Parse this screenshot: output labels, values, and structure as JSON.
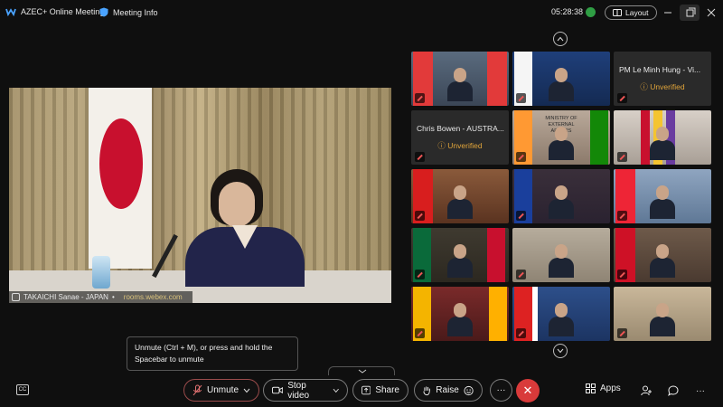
{
  "titlebar": {
    "app_title": "AZEC+ Online Meeting",
    "meeting_info": "Meeting Info",
    "time": "05:28:38",
    "layout_label": "Layout"
  },
  "main_video": {
    "participant_name": "TAKAICHI Sanae - JAPAN",
    "watermark": "rooms.webex.com"
  },
  "grid": {
    "tiles": [
      {
        "type": "video"
      },
      {
        "type": "video"
      },
      {
        "type": "text",
        "name": "PM Le Minh Hung - Vi...",
        "status": "Unverified"
      },
      {
        "type": "text",
        "name": "Chris Bowen - AUSTRA...",
        "status": "Unverified"
      },
      {
        "type": "video",
        "caption": "MINISTRY OF EXTERNAL AFFAIRS"
      },
      {
        "type": "video"
      },
      {
        "type": "video"
      },
      {
        "type": "video"
      },
      {
        "type": "video"
      },
      {
        "type": "video"
      },
      {
        "type": "video"
      },
      {
        "type": "video"
      },
      {
        "type": "video"
      },
      {
        "type": "video"
      },
      {
        "type": "video"
      }
    ]
  },
  "tooltip": {
    "text_line1": "Unmute (Ctrl + M), or press and hold the",
    "text_line2": "Spacebar to unmute"
  },
  "controls": {
    "unmute": "Unmute",
    "stop_video": "Stop video",
    "share": "Share",
    "raise": "Raise",
    "more": "···",
    "apps": "Apps"
  },
  "colors": {
    "accent_red": "#d93a3a",
    "unverified": "#e0a43a",
    "background": "#0f0f0f"
  }
}
